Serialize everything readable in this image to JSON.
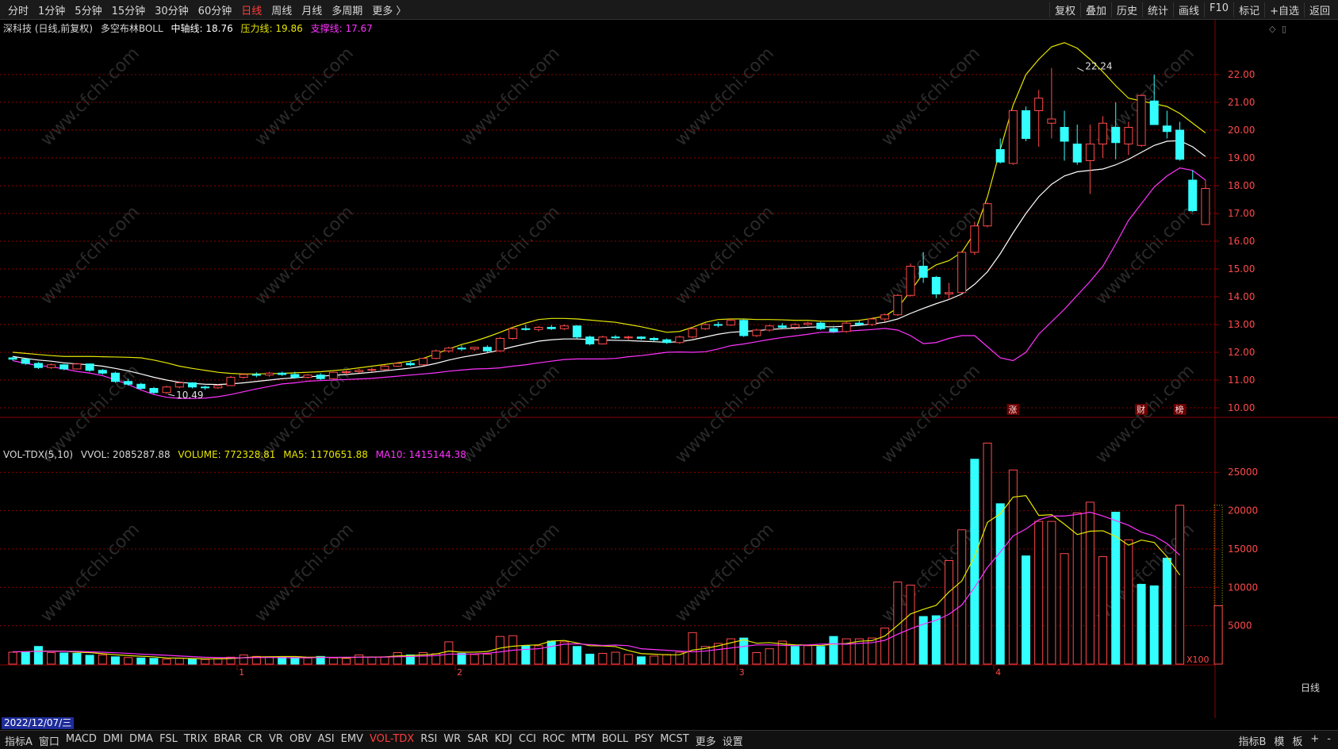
{
  "toolbar": {
    "periods": [
      "分时",
      "1分钟",
      "5分钟",
      "15分钟",
      "30分钟",
      "60分钟",
      "日线",
      "周线",
      "月线",
      "多周期",
      "更多 〉"
    ],
    "active_period": "日线",
    "actions": [
      "复权",
      "叠加",
      "历史",
      "统计",
      "画线",
      "F10",
      "标记",
      "+自选",
      "返回"
    ]
  },
  "main_info": {
    "stock": "深科技 (日线,前复权)",
    "indicator": "多空布林BOLL",
    "mid_label": "中轴线: 18.76",
    "upper_label": "压力线: 19.86",
    "lower_label": "支撑线: 17.67"
  },
  "vol_info": {
    "name": "VOL-TDX(5,10)",
    "vvol": "VVOL: 2085287.88",
    "volume": "VOLUME: 772328.81",
    "ma5": "MA5: 1170651.88",
    "ma10": "MA10: 1415144.38"
  },
  "date_label": "2022/12/07/三",
  "bottom_tabs": [
    "指标A",
    "窗口",
    "MACD",
    "DMI",
    "DMA",
    "FSL",
    "TRIX",
    "BRAR",
    "CR",
    "VR",
    "OBV",
    "ASI",
    "EMV",
    "VOL-TDX",
    "RSI",
    "WR",
    "SAR",
    "KDJ",
    "CCI",
    "ROC",
    "MTM",
    "BOLL",
    "PSY",
    "MCST",
    "更多",
    "设置"
  ],
  "active_tab": "VOL-TDX",
  "bottom_right": [
    "指标B",
    "模",
    "板",
    "+",
    "-"
  ],
  "watermark": "www.cfchi.com",
  "colors": {
    "up": "#ff4a4a",
    "down": "#33ffff",
    "mid": "#ffffff",
    "upper": "#e6e600",
    "lower": "#ff33ff",
    "grid": "#8b0000"
  },
  "chart_data": [
    {
      "type": "candlestick",
      "title": "深科技 (日线,前复权)",
      "y_ticks": [
        10.0,
        11.0,
        12.0,
        13.0,
        14.0,
        15.0,
        16.0,
        17.0,
        18.0,
        19.0,
        20.0,
        21.0,
        22.0
      ],
      "ylim": [
        9.8,
        23.4
      ],
      "x_ticks": [
        "1",
        "2",
        "3",
        "4"
      ],
      "annotations": [
        "22.24",
        "10.49"
      ],
      "markers": [
        "涨",
        "财",
        "榜"
      ],
      "candles": [
        [
          11.8,
          11.85,
          11.7,
          11.75
        ],
        [
          11.75,
          11.78,
          11.55,
          11.6
        ],
        [
          11.6,
          11.65,
          11.4,
          11.45
        ],
        [
          11.45,
          11.6,
          11.4,
          11.55
        ],
        [
          11.55,
          11.58,
          11.35,
          11.4
        ],
        [
          11.4,
          11.62,
          11.38,
          11.58
        ],
        [
          11.58,
          11.6,
          11.3,
          11.35
        ],
        [
          11.35,
          11.4,
          11.2,
          11.25
        ],
        [
          11.25,
          11.3,
          10.9,
          10.95
        ],
        [
          10.95,
          11.05,
          10.8,
          10.85
        ],
        [
          10.85,
          10.9,
          10.65,
          10.7
        ],
        [
          10.7,
          10.75,
          10.5,
          10.55
        ],
        [
          10.55,
          10.8,
          10.49,
          10.75
        ],
        [
          10.75,
          10.95,
          10.7,
          10.9
        ],
        [
          10.9,
          10.92,
          10.7,
          10.75
        ],
        [
          10.75,
          10.8,
          10.65,
          10.72
        ],
        [
          10.72,
          10.85,
          10.68,
          10.8
        ],
        [
          10.8,
          11.15,
          10.78,
          11.1
        ],
        [
          11.1,
          11.25,
          11.05,
          11.2
        ],
        [
          11.2,
          11.28,
          11.1,
          11.18
        ],
        [
          11.18,
          11.3,
          11.12,
          11.25
        ],
        [
          11.25,
          11.3,
          11.15,
          11.2
        ],
        [
          11.2,
          11.3,
          11.05,
          11.1
        ],
        [
          11.1,
          11.22,
          11.05,
          11.18
        ],
        [
          11.18,
          11.25,
          11.0,
          11.05
        ],
        [
          11.05,
          11.3,
          11.02,
          11.28
        ],
        [
          11.28,
          11.35,
          11.2,
          11.3
        ],
        [
          11.3,
          11.4,
          11.25,
          11.35
        ],
        [
          11.35,
          11.45,
          11.3,
          11.38
        ],
        [
          11.38,
          11.55,
          11.35,
          11.5
        ],
        [
          11.5,
          11.65,
          11.48,
          11.6
        ],
        [
          11.6,
          11.7,
          11.5,
          11.55
        ],
        [
          11.55,
          11.8,
          11.52,
          11.78
        ],
        [
          11.78,
          12.1,
          11.75,
          12.05
        ],
        [
          12.05,
          12.2,
          11.98,
          12.15
        ],
        [
          12.15,
          12.25,
          12.05,
          12.12
        ],
        [
          12.12,
          12.2,
          12.05,
          12.18
        ],
        [
          12.18,
          12.25,
          12.0,
          12.05
        ],
        [
          12.05,
          12.55,
          12.02,
          12.5
        ],
        [
          12.5,
          12.9,
          12.45,
          12.85
        ],
        [
          12.85,
          13.0,
          12.78,
          12.82
        ],
        [
          12.82,
          12.95,
          12.75,
          12.9
        ],
        [
          12.9,
          12.98,
          12.8,
          12.85
        ],
        [
          12.85,
          13.0,
          12.8,
          12.95
        ],
        [
          12.95,
          12.98,
          12.5,
          12.55
        ],
        [
          12.55,
          12.6,
          12.25,
          12.3
        ],
        [
          12.3,
          12.6,
          12.28,
          12.55
        ],
        [
          12.55,
          12.62,
          12.48,
          12.52
        ],
        [
          12.52,
          12.6,
          12.45,
          12.55
        ],
        [
          12.55,
          12.58,
          12.45,
          12.5
        ],
        [
          12.5,
          12.55,
          12.4,
          12.45
        ],
        [
          12.45,
          12.5,
          12.3,
          12.35
        ],
        [
          12.35,
          12.6,
          12.3,
          12.55
        ],
        [
          12.55,
          12.9,
          12.5,
          12.85
        ],
        [
          12.85,
          13.05,
          12.8,
          13.0
        ],
        [
          13.0,
          13.1,
          12.9,
          12.98
        ],
        [
          12.98,
          13.2,
          12.95,
          13.15
        ],
        [
          13.15,
          13.2,
          12.55,
          12.6
        ],
        [
          12.6,
          12.85,
          12.55,
          12.8
        ],
        [
          12.8,
          13.0,
          12.75,
          12.95
        ],
        [
          12.95,
          13.05,
          12.85,
          12.9
        ],
        [
          12.9,
          13.05,
          12.8,
          13.0
        ],
        [
          13.0,
          13.1,
          12.95,
          13.05
        ],
        [
          13.05,
          13.1,
          12.8,
          12.85
        ],
        [
          12.85,
          12.95,
          12.7,
          12.75
        ],
        [
          12.75,
          13.1,
          12.7,
          13.05
        ],
        [
          13.05,
          13.15,
          12.95,
          13.0
        ],
        [
          13.0,
          13.25,
          12.95,
          13.2
        ],
        [
          13.2,
          13.4,
          13.1,
          13.35
        ],
        [
          13.35,
          14.1,
          13.3,
          14.05
        ],
        [
          14.05,
          15.2,
          14.0,
          15.1
        ],
        [
          15.1,
          15.6,
          14.5,
          14.7
        ],
        [
          14.7,
          14.75,
          13.95,
          14.1
        ],
        [
          14.1,
          14.5,
          13.9,
          14.15
        ],
        [
          14.15,
          15.65,
          14.1,
          15.6
        ],
        [
          15.6,
          16.7,
          15.5,
          16.55
        ],
        [
          16.55,
          17.4,
          16.5,
          17.35
        ],
        [
          19.3,
          19.7,
          18.8,
          18.85
        ],
        [
          18.8,
          20.7,
          18.75,
          20.7
        ],
        [
          20.7,
          20.85,
          19.6,
          19.7
        ],
        [
          20.7,
          21.45,
          19.4,
          21.15
        ],
        [
          20.25,
          22.24,
          19.7,
          20.4
        ],
        [
          20.1,
          20.7,
          18.9,
          19.6
        ],
        [
          19.5,
          20.2,
          18.75,
          18.85
        ],
        [
          18.9,
          20.2,
          17.7,
          19.5
        ],
        [
          19.5,
          20.5,
          19.0,
          20.25
        ],
        [
          20.1,
          21.0,
          18.95,
          19.55
        ],
        [
          19.5,
          20.3,
          19.1,
          20.1
        ],
        [
          19.45,
          21.3,
          19.4,
          21.25
        ],
        [
          21.05,
          22.0,
          20.7,
          20.2
        ],
        [
          20.15,
          20.7,
          19.7,
          19.95
        ],
        [
          20.0,
          20.3,
          18.9,
          18.95
        ],
        [
          18.2,
          18.55,
          17.05,
          17.1
        ],
        [
          16.6,
          18.2,
          16.6,
          17.9
        ]
      ],
      "boll_mid": [
        11.85,
        11.78,
        11.72,
        11.68,
        11.62,
        11.58,
        11.55,
        11.5,
        11.42,
        11.33,
        11.22,
        11.1,
        11.0,
        10.92,
        10.88,
        10.85,
        10.84,
        10.86,
        10.9,
        10.95,
        11.0,
        11.05,
        11.08,
        11.12,
        11.14,
        11.17,
        11.2,
        11.24,
        11.28,
        11.33,
        11.38,
        11.43,
        11.5,
        11.6,
        11.72,
        11.82,
        11.9,
        11.98,
        12.08,
        12.2,
        12.3,
        12.4,
        12.45,
        12.48,
        12.48,
        12.46,
        12.44,
        12.43,
        12.42,
        12.4,
        12.38,
        12.36,
        12.38,
        12.45,
        12.55,
        12.65,
        12.72,
        12.75,
        12.78,
        12.82,
        12.85,
        12.87,
        12.9,
        12.92,
        12.92,
        12.94,
        12.97,
        13.02,
        13.08,
        13.2,
        13.4,
        13.58,
        13.75,
        13.9,
        14.1,
        14.45,
        14.9,
        15.55,
        16.3,
        17.0,
        17.6,
        18.05,
        18.35,
        18.5,
        18.55,
        18.6,
        18.75,
        18.95,
        19.2,
        19.45,
        19.6,
        19.62,
        19.4,
        19.05
      ],
      "boll_upper": [
        12.0,
        11.96,
        11.92,
        11.88,
        11.85,
        11.85,
        11.85,
        11.84,
        11.83,
        11.82,
        11.8,
        11.72,
        11.62,
        11.5,
        11.42,
        11.35,
        11.28,
        11.24,
        11.22,
        11.22,
        11.23,
        11.24,
        11.26,
        11.28,
        11.3,
        11.34,
        11.38,
        11.44,
        11.5,
        11.56,
        11.62,
        11.68,
        11.78,
        11.94,
        12.12,
        12.28,
        12.4,
        12.55,
        12.72,
        12.9,
        13.05,
        13.18,
        13.22,
        13.22,
        13.2,
        13.16,
        13.12,
        13.08,
        13.0,
        12.92,
        12.82,
        12.72,
        12.75,
        12.9,
        13.08,
        13.18,
        13.2,
        13.2,
        13.18,
        13.18,
        13.17,
        13.15,
        13.15,
        13.12,
        13.12,
        13.12,
        13.15,
        13.22,
        13.3,
        13.6,
        14.2,
        14.85,
        15.15,
        15.3,
        15.6,
        16.3,
        17.6,
        19.3,
        20.9,
        22.0,
        22.55,
        23.0,
        23.15,
        22.95,
        22.55,
        22.1,
        21.6,
        21.15,
        21.05,
        20.95,
        20.85,
        20.6,
        20.25,
        19.9
      ],
      "boll_lower": [
        11.7,
        11.6,
        11.52,
        11.48,
        11.4,
        11.31,
        11.25,
        11.16,
        11.01,
        10.84,
        10.64,
        10.48,
        10.38,
        10.34,
        10.34,
        10.35,
        10.4,
        10.48,
        10.58,
        10.68,
        10.77,
        10.86,
        10.9,
        10.96,
        10.98,
        11.0,
        11.02,
        11.04,
        11.06,
        11.1,
        11.14,
        11.18,
        11.22,
        11.26,
        11.32,
        11.36,
        11.4,
        11.41,
        11.44,
        11.5,
        11.55,
        11.62,
        11.68,
        11.74,
        11.76,
        11.76,
        11.76,
        11.78,
        11.84,
        11.88,
        11.94,
        12.0,
        12.01,
        12.0,
        12.02,
        12.12,
        12.24,
        12.3,
        12.38,
        12.46,
        12.53,
        12.59,
        12.65,
        12.72,
        12.72,
        12.76,
        12.79,
        12.82,
        12.86,
        12.8,
        12.6,
        12.31,
        12.35,
        12.5,
        12.6,
        12.6,
        12.2,
        11.8,
        11.7,
        12.0,
        12.65,
        13.1,
        13.55,
        14.05,
        14.55,
        15.1,
        15.9,
        16.75,
        17.35,
        17.95,
        18.35,
        18.64,
        18.55,
        18.2
      ]
    },
    {
      "type": "bar",
      "title": "VOL-TDX(5,10)",
      "unit": "X100",
      "y_ticks": [
        5000,
        10000,
        15000,
        20000,
        25000
      ],
      "ylim": [
        0,
        30400
      ],
      "volumes": [
        1550,
        1600,
        2300,
        1500,
        1450,
        1400,
        1150,
        1200,
        950,
        850,
        800,
        750,
        650,
        750,
        650,
        600,
        700,
        900,
        1200,
        1000,
        950,
        900,
        850,
        800,
        1000,
        800,
        750,
        1200,
        900,
        950,
        1500,
        1200,
        1500,
        1350,
        2900,
        1400,
        1250,
        1300,
        3600,
        3700,
        2400,
        2400,
        3000,
        2900,
        2300,
        1300,
        1400,
        1550,
        1250,
        950,
        1050,
        1250,
        1550,
        4100,
        2300,
        2700,
        3300,
        3400,
        1500,
        2000,
        3000,
        2300,
        2400,
        2300,
        3600,
        3300,
        3300,
        3400,
        4700,
        10700,
        10300,
        6200,
        6300,
        13500,
        17500,
        26700,
        28800,
        20900,
        25300,
        14100,
        18600,
        18600,
        14400,
        19700,
        21100,
        14000,
        19800,
        16200,
        10400,
        10200,
        13800,
        20700
      ],
      "up": [
        1,
        0,
        0,
        1,
        0,
        0,
        0,
        1,
        0,
        1,
        0,
        0,
        1,
        1,
        0,
        1,
        1,
        1,
        1,
        1,
        1,
        0,
        0,
        1,
        0,
        1,
        1,
        1,
        1,
        1,
        1,
        0,
        1,
        1,
        1,
        0,
        1,
        1,
        1,
        1,
        0,
        1,
        0,
        1,
        0,
        0,
        1,
        1,
        1,
        0,
        1,
        1,
        1,
        1,
        1,
        1,
        1,
        0,
        1,
        1,
        1,
        0,
        1,
        0,
        0,
        1,
        1,
        1,
        1,
        1,
        1,
        0,
        0,
        1,
        1,
        0,
        1,
        0,
        1,
        0,
        1,
        1,
        1,
        1,
        1,
        1,
        0,
        1,
        0,
        0,
        0,
        1
      ],
      "last_vol": 7600,
      "ma5": [
        1600,
        1610,
        1700,
        1690,
        1680,
        1550,
        1500,
        1360,
        1220,
        1110,
        1020,
        950,
        800,
        780,
        720,
        690,
        680,
        720,
        840,
        930,
        950,
        990,
        980,
        900,
        910,
        870,
        830,
        910,
        920,
        930,
        1060,
        1110,
        1210,
        1310,
        1690,
        1550,
        1560,
        1640,
        2090,
        2330,
        2450,
        2510,
        3020,
        3080,
        2760,
        2400,
        2370,
        2280,
        1760,
        1370,
        1290,
        1210,
        1220,
        1830,
        2040,
        2380,
        2780,
        3170,
        2720,
        2800,
        2640,
        2510,
        2480,
        2410,
        2600,
        2680,
        2980,
        3060,
        3660,
        5060,
        6540,
        7140,
        7660,
        9400,
        10840,
        14040,
        18480,
        19580,
        21760,
        21960,
        19380,
        19480,
        18240,
        16880,
        17320,
        17380,
        16640,
        15500,
        16160,
        15860,
        14000,
        11600
      ],
      "ma10": [
        1600,
        1620,
        1660,
        1670,
        1670,
        1660,
        1600,
        1550,
        1480,
        1400,
        1300,
        1230,
        1150,
        1060,
        970,
        890,
        850,
        830,
        820,
        850,
        860,
        840,
        830,
        820,
        860,
        880,
        900,
        900,
        900,
        910,
        950,
        990,
        1050,
        1110,
        1300,
        1300,
        1320,
        1410,
        1590,
        1810,
        1920,
        2000,
        2300,
        2600,
        2650,
        2540,
        2430,
        2480,
        2400,
        2000,
        1900,
        1800,
        1700,
        1600,
        1700,
        1900,
        2100,
        2300,
        2500,
        2500,
        2450,
        2400,
        2500,
        2600,
        2650,
        2600,
        2700,
        2800,
        3100,
        3900,
        4600,
        5200,
        5700,
        6500,
        7700,
        10000,
        12600,
        14600,
        16700,
        17600,
        18800,
        19300,
        19300,
        19500,
        19800,
        19300,
        18700,
        18100,
        17200,
        16700,
        15700,
        14200
      ]
    }
  ]
}
